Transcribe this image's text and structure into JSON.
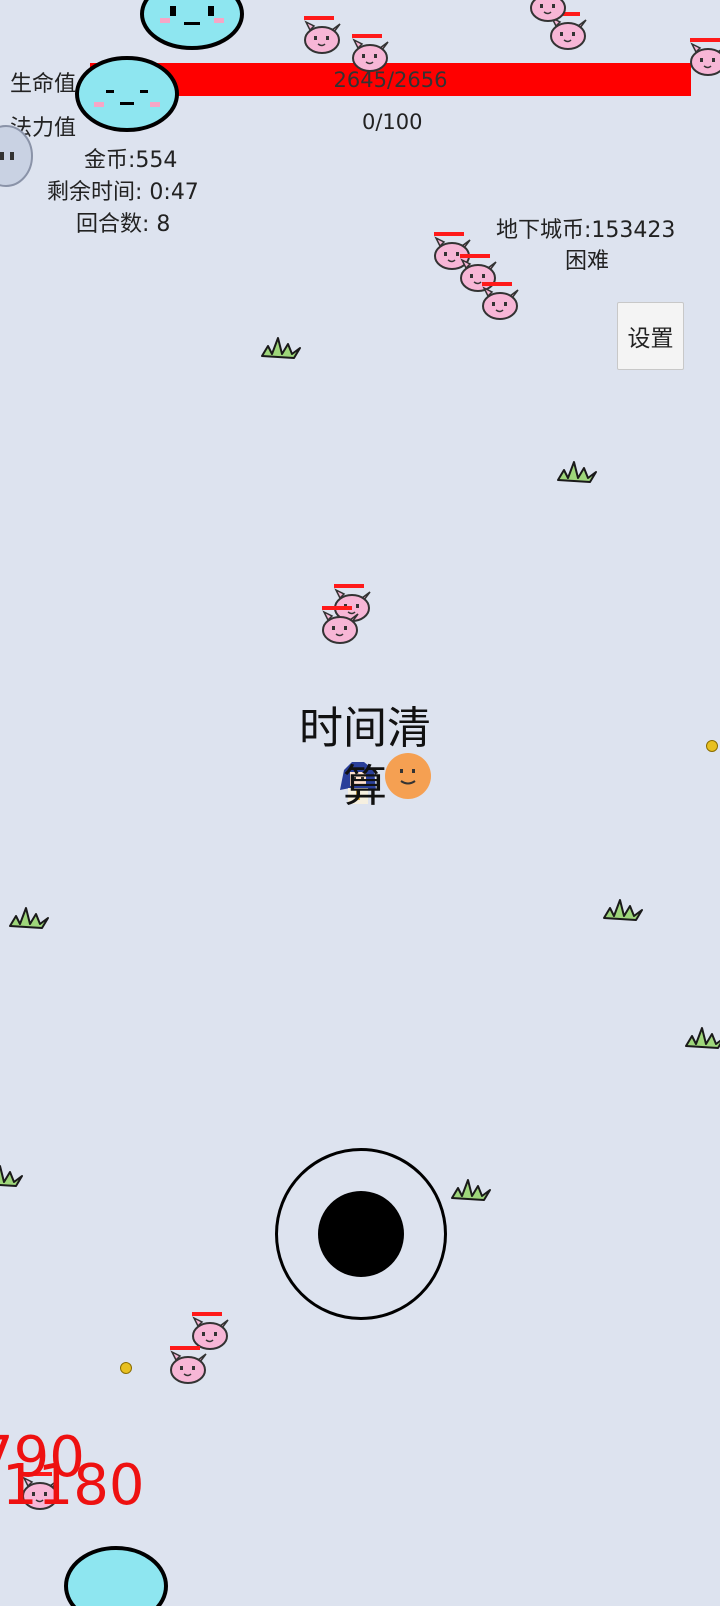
{
  "hud": {
    "hp_label": "生命值",
    "hp_value": "2645/2656",
    "hp_fraction": 0.996,
    "mp_label": "法力值",
    "mp_value": "0/100",
    "gold": "金币:554",
    "time_left": "剩余时间:  0:47",
    "round": "回合数:  8",
    "dungeon_coins": "地下城币:153423",
    "difficulty": "困难",
    "settings_label": "设置"
  },
  "center_message": "时间清算",
  "damage_numbers": [
    "790",
    "1180"
  ],
  "colors": {
    "background": "#dde3ef",
    "hp_bar": "#ff0000",
    "damage_text": "#ee1111",
    "enemy": "#f7b6d6",
    "slime": "#8ee6f0"
  }
}
